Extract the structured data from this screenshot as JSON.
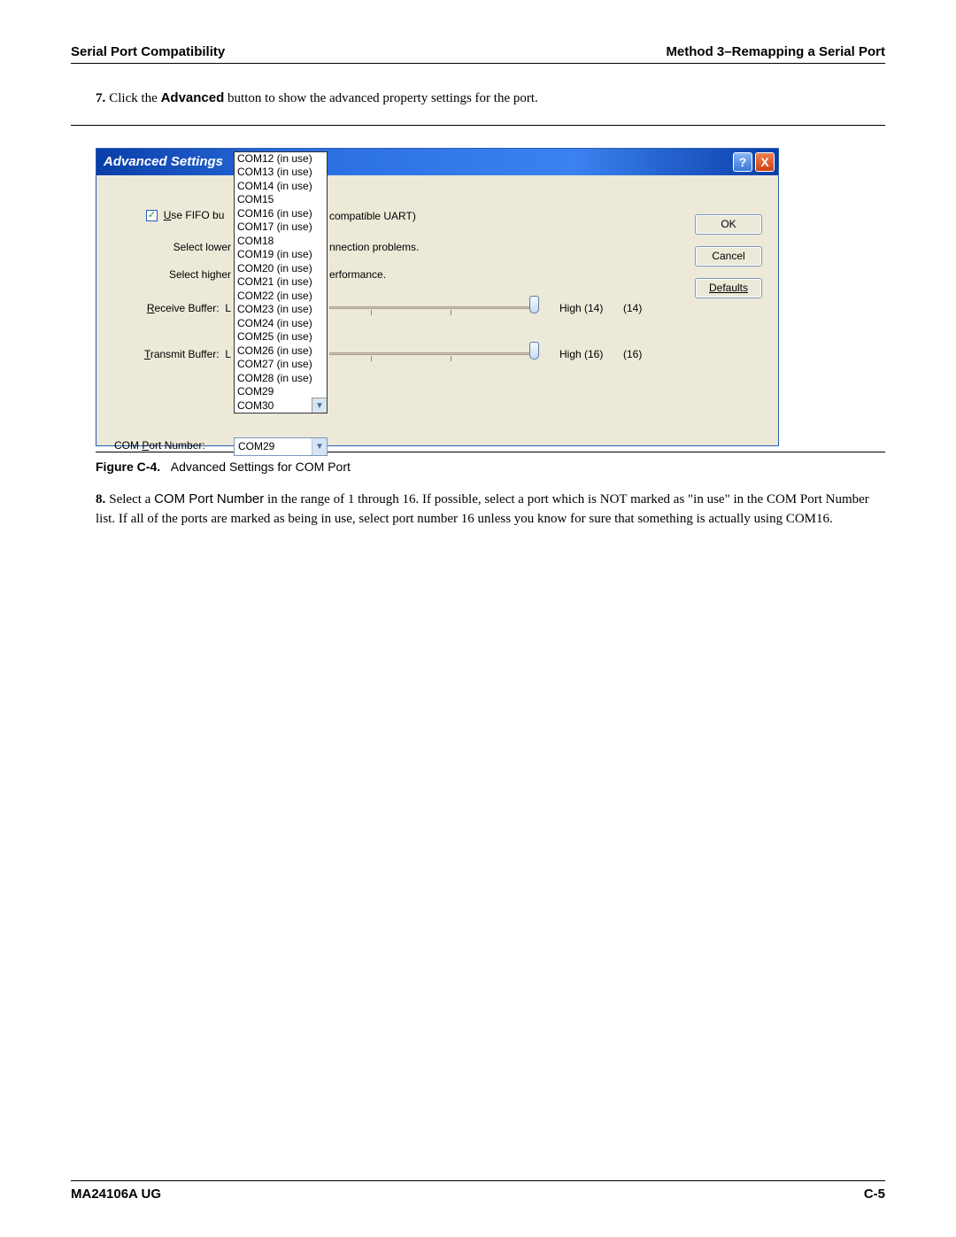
{
  "header": {
    "left": "Serial Port Compatibility",
    "right": "Method 3–Remapping a Serial Port"
  },
  "step7": {
    "num": "7.",
    "pre": "Click the ",
    "bold": "Advanced",
    "post": " button to show the advanced property settings for the port."
  },
  "dialog": {
    "title": "Advanced Settings",
    "help": "?",
    "close": "X",
    "buttons": {
      "ok": "OK",
      "cancel": "Cancel",
      "defaults": "Defaults"
    },
    "fifo_label_pre": "se FIFO bu",
    "fifo_u": "U",
    "labels": {
      "lower": "Select lower",
      "higher": "Select higher",
      "receive": "Receive Buffer:",
      "receive_u": "R",
      "receive_suffix": "L",
      "transmit": "ransmit Buffer:",
      "transmit_u": "T",
      "transmit_suffix": "L",
      "comport": "COM ",
      "comport_u": "P",
      "comport_rest": "ort Number:"
    },
    "fragments": {
      "uart": "compatible UART)",
      "conn": "nnection problems.",
      "perf": "erformance.",
      "high14": "High (14)",
      "v14": "(14)",
      "high16": "High (16)",
      "v16": "(16)"
    },
    "dropdown": {
      "items": [
        "COM12 (in use)",
        "COM13 (in use)",
        "COM14 (in use)",
        "COM15",
        "COM16 (in use)",
        "COM17 (in use)",
        "COM18",
        "COM19 (in use)",
        "COM20 (in use)",
        "COM21 (in use)",
        "COM22 (in use)",
        "COM23 (in use)",
        "COM24 (in use)",
        "COM25 (in use)",
        "COM26 (in use)",
        "COM27 (in use)",
        "COM28 (in use)",
        "COM29",
        "COM30"
      ]
    },
    "combo_value": "COM29"
  },
  "caption": {
    "label": "Figure C-4.",
    "text": "Advanced Settings for COM Port"
  },
  "step8": {
    "num": "8.",
    "pre": "Select a ",
    "bold": "COM Port Number",
    "post": " in the range of 1 through 16. If possible, select a port which is NOT marked as \"in use\" in the COM Port Number list. If all of the ports are marked as being in use, select port number 16 unless you know for sure that something is actually using COM16."
  },
  "footer": {
    "left": "MA24106A UG",
    "right": "C-5"
  }
}
